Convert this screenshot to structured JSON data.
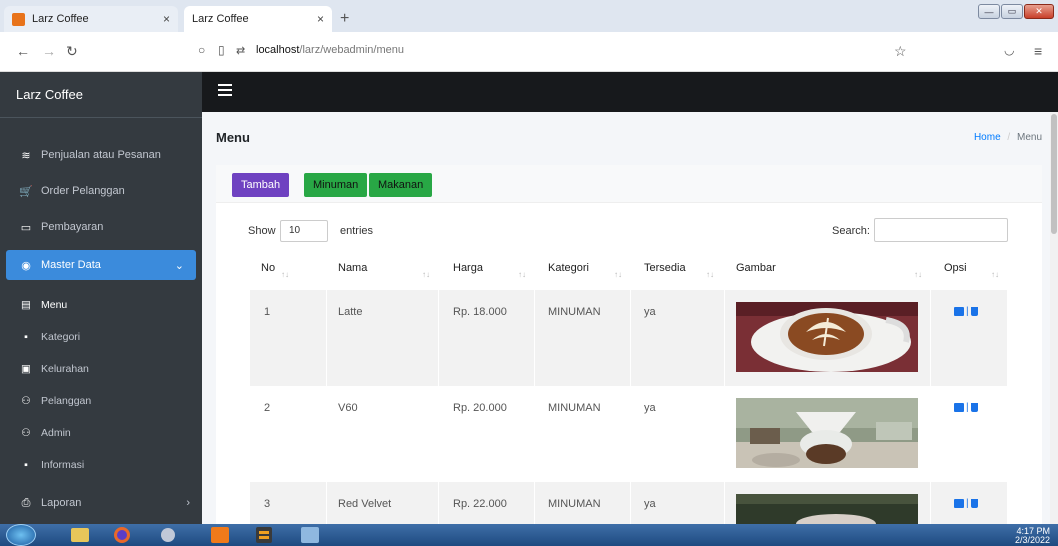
{
  "browser": {
    "tabs": [
      {
        "title": "Larz Coffee",
        "close": "×"
      },
      {
        "title": "Larz Coffee",
        "close": "×"
      }
    ],
    "new_tab": "+",
    "url_host": "localhost",
    "url_path": "/larz/webadmin/menu"
  },
  "sidebar": {
    "brand": "Larz Coffee",
    "items": [
      {
        "label": "Penjualan atau Pesanan",
        "icon": "layers-icon"
      },
      {
        "label": "Order Pelanggan",
        "icon": "cart-icon"
      },
      {
        "label": "Pembayaran",
        "icon": "monitor-icon"
      },
      {
        "label": "Master Data",
        "icon": "database-icon"
      },
      {
        "label": "Menu",
        "icon": "list-icon"
      },
      {
        "label": "Kategori",
        "icon": "tag-icon"
      },
      {
        "label": "Kelurahan",
        "icon": "table-icon"
      },
      {
        "label": "Pelanggan",
        "icon": "users-icon"
      },
      {
        "label": "Admin",
        "icon": "users-icon"
      },
      {
        "label": "Informasi",
        "icon": "info-icon"
      },
      {
        "label": "Laporan",
        "icon": "print-icon"
      }
    ]
  },
  "content": {
    "title": "Menu",
    "breadcrumb": {
      "home": "Home",
      "current": "Menu"
    },
    "buttons": {
      "tambah": "Tambah",
      "minuman": "Minuman",
      "makanan": "Makanan"
    },
    "show": "Show",
    "entries_value": "10",
    "entries": "entries",
    "search_label": "Search:"
  },
  "table": {
    "headers": [
      "No",
      "Nama",
      "Harga",
      "Kategori",
      "Tersedia",
      "Gambar",
      "Opsi"
    ],
    "rows": [
      {
        "no": "1",
        "nama": "Latte",
        "harga": "Rp. 18.000",
        "kategori": "MINUMAN",
        "tersedia": "ya"
      },
      {
        "no": "2",
        "nama": "V60",
        "harga": "Rp. 20.000",
        "kategori": "MINUMAN",
        "tersedia": "ya"
      },
      {
        "no": "3",
        "nama": "Red Velvet",
        "harga": "Rp. 22.000",
        "kategori": "MINUMAN",
        "tersedia": "ya"
      }
    ]
  },
  "taskbar": {
    "time": "4:17 PM",
    "date": "2/3/2022"
  },
  "colors": {
    "sidebar": "#343a40",
    "active": "#3b8bdc",
    "tambah": "#6f42c1",
    "green": "#28a745"
  }
}
